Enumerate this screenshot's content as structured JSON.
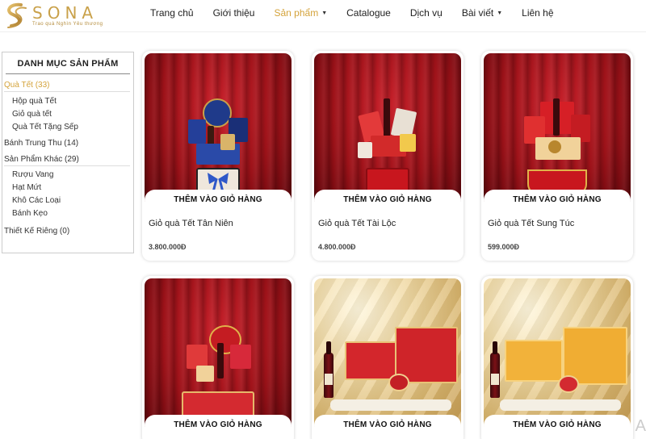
{
  "brand": {
    "name": "SONA",
    "tagline": "Trao quà Nghìn Yêu thương",
    "gold": "#d4a33b"
  },
  "nav": {
    "items": [
      {
        "label": "Trang chủ",
        "dropdown": false,
        "active": false
      },
      {
        "label": "Giới thiệu",
        "dropdown": false,
        "active": false
      },
      {
        "label": "Sản phẩm",
        "dropdown": true,
        "active": true
      },
      {
        "label": "Catalogue",
        "dropdown": false,
        "active": false
      },
      {
        "label": "Dịch vụ",
        "dropdown": false,
        "active": false
      },
      {
        "label": "Bài viết",
        "dropdown": true,
        "active": false
      },
      {
        "label": "Liên hệ",
        "dropdown": false,
        "active": false
      }
    ],
    "caret_icon": "chevron-down-icon"
  },
  "sidebar": {
    "title": "DANH MỤC SẢN PHẨM",
    "categories": [
      {
        "label": "Quà Tết (33)",
        "active": true,
        "children": [
          "Hộp quà Tết",
          "Giỏ quà tết",
          "Quà Tết Tặng Sếp"
        ]
      },
      {
        "label": "Bánh Trung Thu (14)",
        "active": false,
        "children": []
      },
      {
        "label": "Sản Phẩm Khác (29)",
        "active": false,
        "children": [
          "Rượu Vang",
          "Hạt Mứt",
          "Khô Các Loại",
          "Bánh Kẹo"
        ]
      },
      {
        "label": "Thiết Kế Riêng (0)",
        "active": false,
        "children": []
      }
    ]
  },
  "products": {
    "add_to_cart_label": "THÊM VÀO GIỎ HÀNG",
    "items": [
      {
        "name": "Giỏ quà Tết Tân Niên",
        "price": "3.800.000Đ"
      },
      {
        "name": "Giỏ quà Tết Tài Lộc",
        "price": "4.800.000Đ"
      },
      {
        "name": "Giỏ quà Tết Sung Túc",
        "price": "599.000Đ"
      },
      {
        "name": "",
        "price": ""
      },
      {
        "name": "",
        "price": ""
      },
      {
        "name": "",
        "price": ""
      }
    ]
  },
  "edge_text": "A"
}
